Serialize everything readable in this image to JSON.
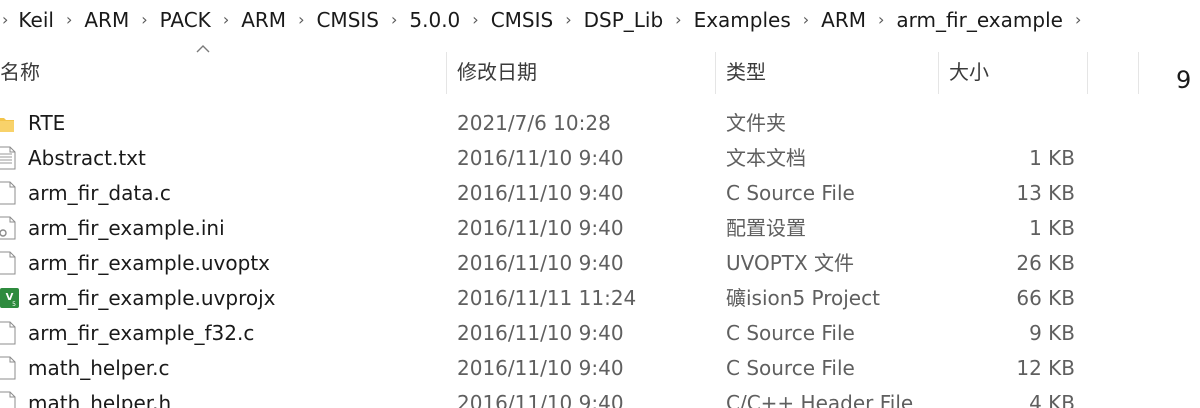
{
  "breadcrumb": {
    "items": [
      "Keil",
      "ARM",
      "PACK",
      "ARM",
      "CMSIS",
      "5.0.0",
      "CMSIS",
      "DSP_Lib",
      "Examples",
      "ARM",
      "arm_fir_example"
    ]
  },
  "columns": {
    "name": "名称",
    "date": "修改日期",
    "type": "类型",
    "size": "大小"
  },
  "edge_text": "9",
  "files": [
    {
      "name": "RTE",
      "date": "2021/7/6 10:28",
      "type": "文件夹",
      "size": "",
      "icon": "folder-icon"
    },
    {
      "name": "Abstract.txt",
      "date": "2016/11/10 9:40",
      "type": "文本文档",
      "size": "1 KB",
      "icon": "text-file-icon"
    },
    {
      "name": "arm_fir_data.c",
      "date": "2016/11/10 9:40",
      "type": "C Source File",
      "size": "13 KB",
      "icon": "file-icon"
    },
    {
      "name": "arm_fir_example.ini",
      "date": "2016/11/10 9:40",
      "type": "配置设置",
      "size": "1 KB",
      "icon": "settings-file-icon"
    },
    {
      "name": "arm_fir_example.uvoptx",
      "date": "2016/11/10 9:40",
      "type": "UVOPTX 文件",
      "size": "26 KB",
      "icon": "file-icon"
    },
    {
      "name": "arm_fir_example.uvprojx",
      "date": "2016/11/11 11:24",
      "type": "礦ision5 Project",
      "size": "66 KB",
      "icon": "uvision-project-icon"
    },
    {
      "name": "arm_fir_example_f32.c",
      "date": "2016/11/10 9:40",
      "type": "C Source File",
      "size": "9 KB",
      "icon": "file-icon"
    },
    {
      "name": "math_helper.c",
      "date": "2016/11/10 9:40",
      "type": "C Source File",
      "size": "12 KB",
      "icon": "file-icon"
    },
    {
      "name": "math_helper.h",
      "date": "2016/11/10 9:40",
      "type": "C/C++ Header File",
      "size": "4 KB",
      "icon": "file-icon"
    }
  ],
  "colors": {
    "folder": "#f3c44a",
    "uvision": "#2e8b3e",
    "secondary_text": "#5f5f5f",
    "divider": "#e5e5e5"
  }
}
